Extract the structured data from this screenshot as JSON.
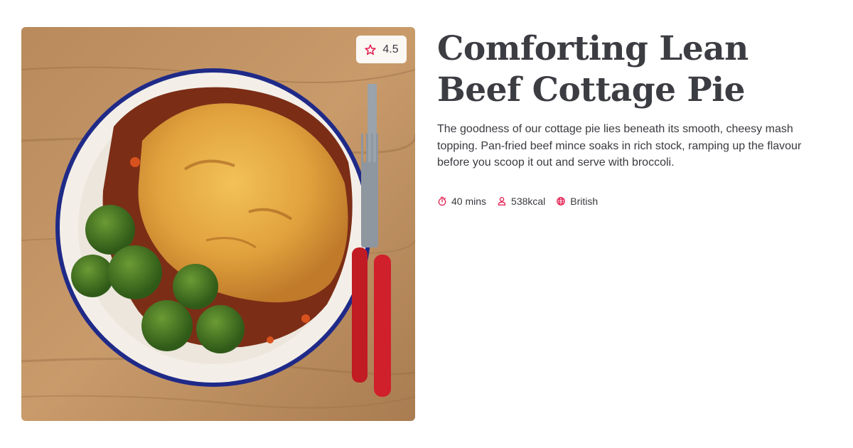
{
  "recipe": {
    "title": "Comforting Lean Beef Cottage Pie",
    "description": "The goodness of our cottage pie lies beneath its smooth, cheesy mash topping. Pan-fried beef mince soaks in rich stock, ramping up the flavour before you scoop it out and serve with broccoli.",
    "rating": "4.5",
    "meta": {
      "time": "40 mins",
      "calories": "538kcal",
      "cuisine": "British"
    }
  },
  "icons": {
    "rating": "star-outline-icon",
    "time": "stopwatch-icon",
    "calories": "person-icon",
    "cuisine": "globe-icon"
  },
  "colors": {
    "accent": "#e3194d",
    "text": "#3a3a40",
    "title": "#3c3d42"
  }
}
